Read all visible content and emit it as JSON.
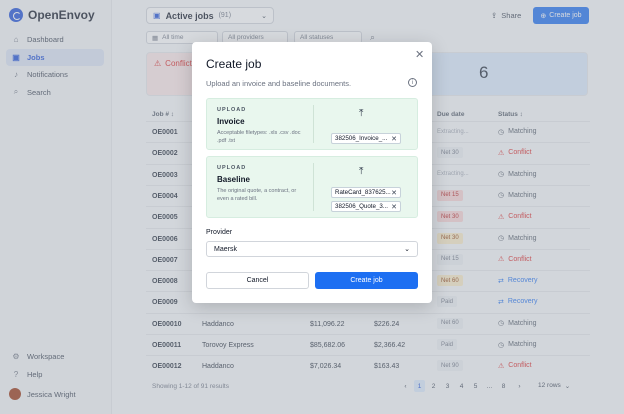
{
  "app": {
    "name": "OpenEnvoy"
  },
  "sidebar": {
    "items": [
      {
        "label": "Dashboard",
        "icon": "home-icon"
      },
      {
        "label": "Jobs",
        "icon": "briefcase-icon"
      },
      {
        "label": "Notifications",
        "icon": "bell-icon"
      },
      {
        "label": "Search",
        "icon": "search-icon"
      }
    ],
    "bottom": [
      {
        "label": "Workspace",
        "icon": "gear-icon"
      },
      {
        "label": "Help",
        "icon": "help-icon"
      }
    ],
    "user": "Jessica Wright"
  },
  "header": {
    "view_title": "Active jobs",
    "view_count": "(91)",
    "share_label": "Share",
    "create_label": "Create job"
  },
  "filters": {
    "time": "All time",
    "providers": "All providers",
    "statuses": "All statuses"
  },
  "summary": {
    "conflict_label": "Conflict",
    "count": "6"
  },
  "table": {
    "headers": {
      "job": "Job #",
      "due": "Due date",
      "status": "Status"
    },
    "rows": [
      {
        "job": "OE0001",
        "c2": "",
        "c3": "",
        "c4": "",
        "due": "Extracting...",
        "due_style": "plain",
        "status": "Matching",
        "status_type": "matching"
      },
      {
        "job": "OE0002",
        "c2": "",
        "c3": "",
        "c4": "",
        "due": "Net 30",
        "due_style": "grey",
        "status": "Conflict",
        "status_type": "conflict"
      },
      {
        "job": "OE0003",
        "c2": "",
        "c3": "",
        "c4": "",
        "due": "Extracting...",
        "due_style": "plain",
        "status": "Matching",
        "status_type": "matching"
      },
      {
        "job": "OE0004",
        "c2": "",
        "c3": "",
        "c4": "",
        "due": "Net 15",
        "due_style": "red",
        "status": "Matching",
        "status_type": "matching"
      },
      {
        "job": "OE0005",
        "c2": "",
        "c3": "",
        "c4": "",
        "due": "Net 30",
        "due_style": "red",
        "status": "Conflict",
        "status_type": "conflict"
      },
      {
        "job": "OE0006",
        "c2": "",
        "c3": "",
        "c4": "",
        "due": "Net 30",
        "due_style": "amber",
        "status": "Matching",
        "status_type": "matching"
      },
      {
        "job": "OE0007",
        "c2": "",
        "c3": "",
        "c4": "",
        "due": "Net 15",
        "due_style": "grey",
        "status": "Conflict",
        "status_type": "conflict"
      },
      {
        "job": "OE0008",
        "c2": "",
        "c3": "",
        "c4": "",
        "due": "Net 60",
        "due_style": "amber",
        "status": "Recovery",
        "status_type": "recovery"
      },
      {
        "job": "OE0009",
        "c2": "",
        "c3": "",
        "c4": "",
        "due": "Paid",
        "due_style": "grey",
        "status": "Recovery",
        "status_type": "recovery"
      },
      {
        "job": "OE00010",
        "c2": "Haddanco",
        "c3": "$11,096.22",
        "c4": "$226.24",
        "due": "Net 60",
        "due_style": "grey",
        "status": "Matching",
        "status_type": "matching"
      },
      {
        "job": "OE00011",
        "c2": "Torovoy Express",
        "c3": "$85,682.06",
        "c4": "$2,366.42",
        "due": "Paid",
        "due_style": "grey",
        "status": "Matching",
        "status_type": "matching"
      },
      {
        "job": "OE00012",
        "c2": "Haddanco",
        "c3": "$7,026.34",
        "c4": "$163.43",
        "due": "Net 90",
        "due_style": "grey",
        "status": "Conflict",
        "status_type": "conflict"
      }
    ]
  },
  "pagination": {
    "summary": "Showing 1-12 of 91 results",
    "pages": [
      "1",
      "2",
      "3",
      "4",
      "5",
      "...",
      "8"
    ],
    "rows_label": "12 rows"
  },
  "modal": {
    "title": "Create job",
    "subtitle": "Upload an invoice and baseline documents.",
    "invoice": {
      "kicker": "UPLOAD",
      "name": "Invoice",
      "help": "Acceptable filetypes: .xls .csv .doc .pdf .txt",
      "files": [
        "382506_Invoice_..."
      ]
    },
    "baseline": {
      "kicker": "UPLOAD",
      "name": "Baseline",
      "help": "The original quote, a contract, or even a rated bill.",
      "files": [
        "RateCard_837625...",
        "382506_Quote_3..."
      ]
    },
    "provider_label": "Provider",
    "provider_value": "Maersk",
    "cancel_label": "Cancel",
    "create_label": "Create job"
  },
  "colors": {
    "accent": "#1d6ff2",
    "conflict": "#dc2626",
    "matching": "#4b5563",
    "recovery": "#1d6ff2",
    "upload_bg": "#e9f7ee"
  }
}
